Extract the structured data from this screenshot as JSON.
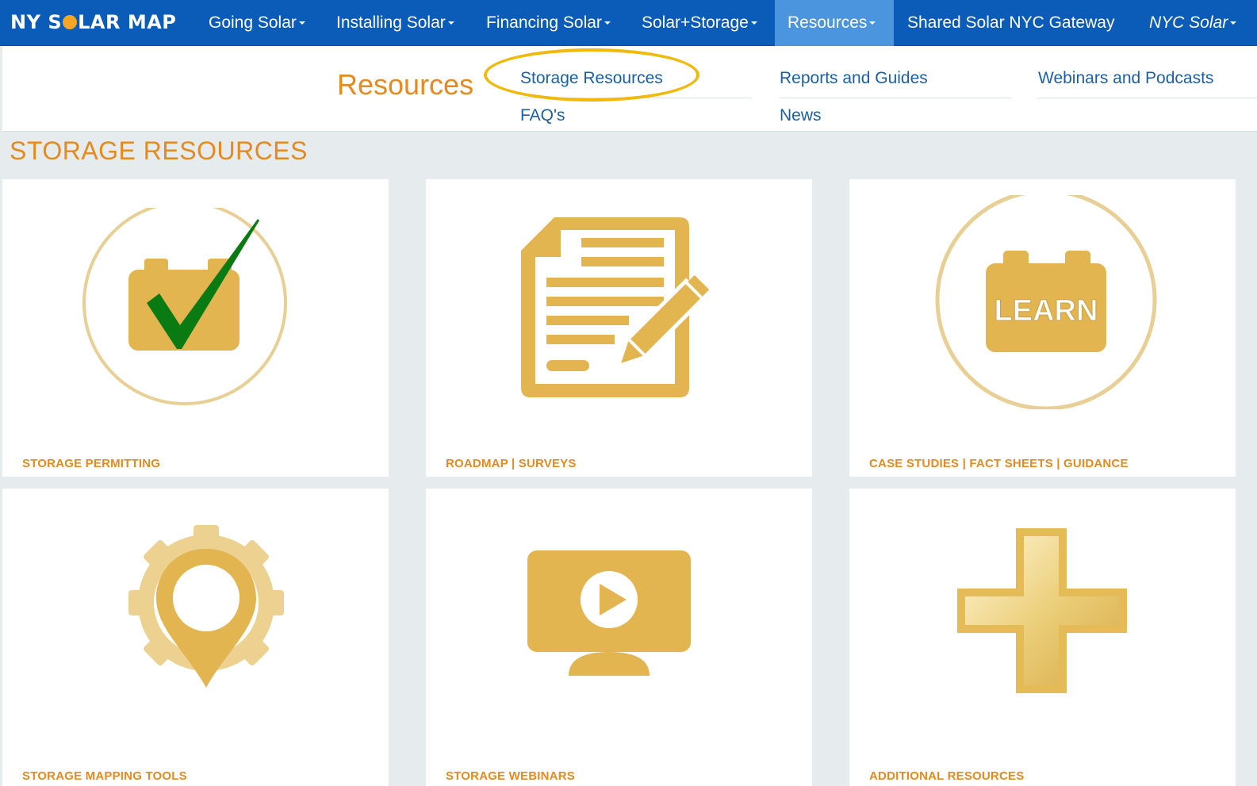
{
  "brand": {
    "logo_text_1": "NY S",
    "logo_text_2": "LAR MAP"
  },
  "nav": {
    "items": [
      {
        "label": "Going Solar",
        "dropdown": true
      },
      {
        "label": "Installing Solar",
        "dropdown": true
      },
      {
        "label": "Financing Solar",
        "dropdown": true
      },
      {
        "label": "Solar+Storage",
        "dropdown": true
      },
      {
        "label": "Resources",
        "dropdown": true,
        "active": true
      },
      {
        "label": "Shared Solar NYC Gateway",
        "dropdown": false
      },
      {
        "label": "NYC Solar",
        "dropdown": true
      }
    ]
  },
  "dropdown": {
    "title": "Resources",
    "links": [
      "Storage Resources",
      "Reports and Guides",
      "Webinars and Podcasts",
      "FAQ's",
      "News"
    ]
  },
  "section": {
    "title": "STORAGE RESOURCES"
  },
  "cards": [
    {
      "label": "STORAGE PERMITTING",
      "icon": "battery-check-icon"
    },
    {
      "label": "ROADMAP | SURVEYS",
      "icon": "document-pencil-icon"
    },
    {
      "label": "CASE STUDIES | FACT SHEETS | GUIDANCE",
      "icon": "battery-learn-icon",
      "icon_text": "LEARN"
    },
    {
      "label": "STORAGE MAPPING TOOLS",
      "icon": "gear-pin-icon"
    },
    {
      "label": "STORAGE WEBINARS",
      "icon": "video-monitor-icon"
    },
    {
      "label": "ADDITIONAL RESOURCES",
      "icon": "plus-icon"
    }
  ],
  "colors": {
    "nav_bg": "#0b5cb8",
    "nav_active": "#4b95df",
    "accent_orange": "#e58a1f",
    "icon_gold": "#e2b550",
    "highlight": "#f0b90b"
  }
}
